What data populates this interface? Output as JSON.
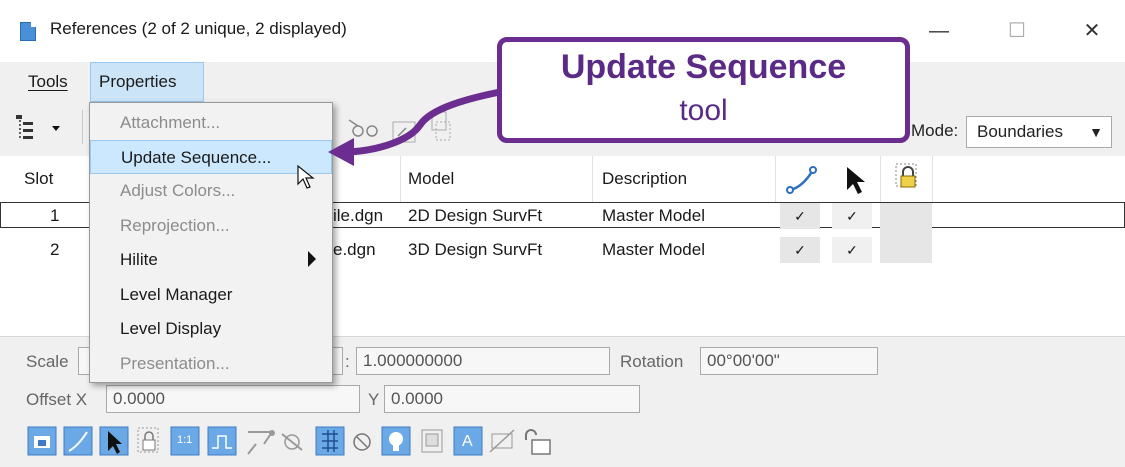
{
  "window": {
    "title": "References (2 of 2 unique, 2 displayed)",
    "minimize_glyph": "—",
    "maximize_glyph": "☐",
    "close_glyph": "✕"
  },
  "menubar": {
    "items": [
      {
        "label": "Tools"
      },
      {
        "label": "Properties"
      }
    ]
  },
  "toolbar": {
    "mode_label": "Mode:",
    "mode_value": "Boundaries"
  },
  "properties_menu": {
    "items": [
      {
        "label": "Attachment...",
        "enabled": false
      },
      {
        "label": "Update Sequence...",
        "enabled": true,
        "highlighted": true
      },
      {
        "label": "Adjust Colors...",
        "enabled": false
      },
      {
        "label": "Reprojection...",
        "enabled": false
      },
      {
        "label": "Hilite",
        "enabled": true,
        "submenu": true
      },
      {
        "label": "Level Manager",
        "enabled": true
      },
      {
        "label": "Level Display",
        "enabled": true
      },
      {
        "label": "Presentation...",
        "enabled": false
      }
    ]
  },
  "table": {
    "headers": {
      "slot": "Slot",
      "model": "Model",
      "description": "Description"
    },
    "rows": [
      {
        "slot": "1",
        "file": "ile.dgn",
        "model": "2D Design SurvFt",
        "description": "Master Model",
        "display": "✓",
        "snap": "✓"
      },
      {
        "slot": "2",
        "file": "e.dgn",
        "model": "3D Design SurvFt",
        "description": "Master Model",
        "display": "✓",
        "snap": "✓"
      }
    ]
  },
  "bottom_panel": {
    "scale_label": "Scale",
    "scale_sep": ":",
    "scale_value": "1.000000000",
    "rotation_label": "Rotation",
    "rotation_value": "00°00'00\"",
    "offset_x_label": "Offset X",
    "offset_x_value": "0.0000",
    "y_label": "Y",
    "y_value": "0.0000"
  },
  "callout": {
    "title": "Update Sequence",
    "subtitle": "tool"
  },
  "colors": {
    "callout_purple": "#6b2d8f",
    "menu_highlight": "#cce8ff",
    "arrow_purple": "#6b2d8f"
  }
}
